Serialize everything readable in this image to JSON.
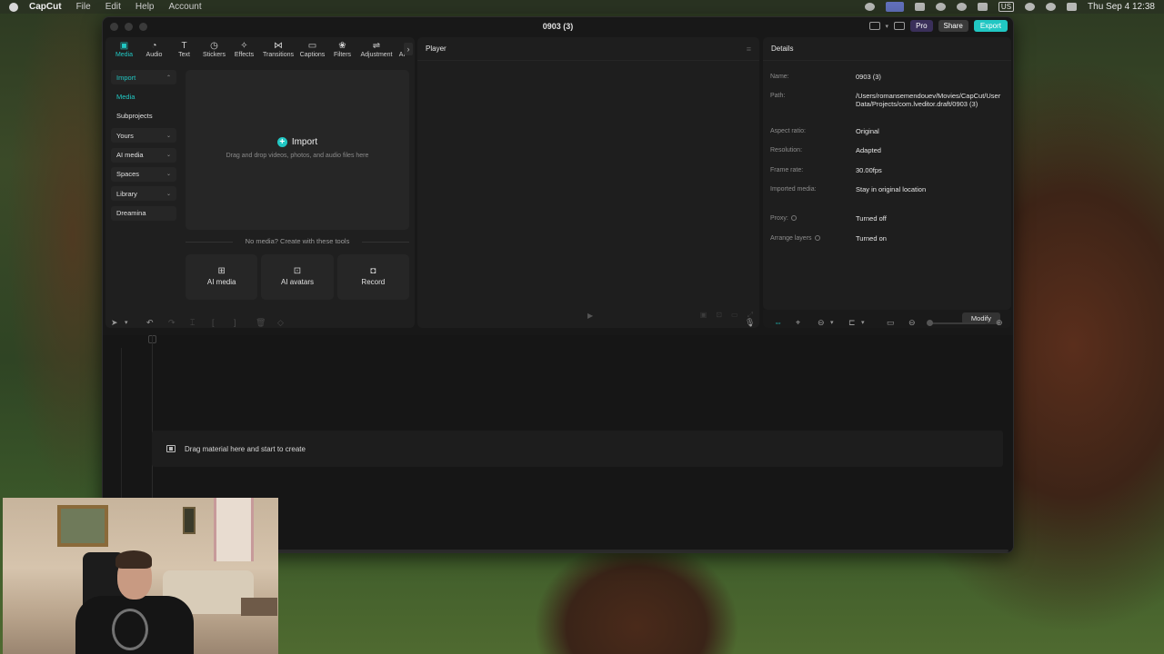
{
  "menubar": {
    "app": "CapCut",
    "menus": [
      "File",
      "Edit",
      "Help",
      "Account"
    ],
    "input_source": "US",
    "clock": "Thu Sep 4  12:38"
  },
  "window": {
    "title": "0903 (3)",
    "pro_label": "Pro",
    "share_label": "Share",
    "export_label": "Export"
  },
  "tools": [
    {
      "label": "Media",
      "icon": "media-icon",
      "glyph": "▣"
    },
    {
      "label": "Audio",
      "icon": "audio-icon",
      "glyph": "◔"
    },
    {
      "label": "Text",
      "icon": "text-icon",
      "glyph": "T"
    },
    {
      "label": "Stickers",
      "icon": "stickers-icon",
      "glyph": "◷"
    },
    {
      "label": "Effects",
      "icon": "effects-icon",
      "glyph": "✧"
    },
    {
      "label": "Transitions",
      "icon": "transitions-icon",
      "glyph": "⋈"
    },
    {
      "label": "Captions",
      "icon": "captions-icon",
      "glyph": "▭"
    },
    {
      "label": "Filters",
      "icon": "filters-icon",
      "glyph": "❀"
    },
    {
      "label": "Adjustment",
      "icon": "adjustment-icon",
      "glyph": "⇌"
    },
    {
      "label": "AI",
      "icon": "ai-icon",
      "glyph": ""
    }
  ],
  "subnav": [
    {
      "label": "Import",
      "expanded": true
    },
    {
      "label": "Media"
    },
    {
      "label": "Subprojects"
    },
    {
      "label": "Yours"
    },
    {
      "label": "AI media"
    },
    {
      "label": "Spaces"
    },
    {
      "label": "Library"
    },
    {
      "label": "Dreamina"
    }
  ],
  "dropzone": {
    "import_label": "Import",
    "hint": "Drag and drop videos, photos, and audio files here"
  },
  "no_media_text": "No media? Create with these tools",
  "create_tools": [
    {
      "label": "AI media",
      "icon": "ai-media-icon"
    },
    {
      "label": "AI avatars",
      "icon": "ai-avatars-icon"
    },
    {
      "label": "Record",
      "icon": "record-icon"
    }
  ],
  "player": {
    "title": "Player"
  },
  "details": {
    "title": "Details",
    "rows": [
      {
        "label": "Name:",
        "value": "0903 (3)"
      },
      {
        "label": "Path:",
        "value": "/Users/romansemendouev/Movies/CapCut/User Data/Projects/com.lveditor.draft/0903 (3)"
      },
      {
        "label": "Aspect ratio:",
        "value": "Original"
      },
      {
        "label": "Resolution:",
        "value": "Adapted"
      },
      {
        "label": "Frame rate:",
        "value": "30.00fps"
      },
      {
        "label": "Imported media:",
        "value": "Stay in original location"
      },
      {
        "label": "Proxy:",
        "value": "Turned off"
      },
      {
        "label": "Arrange layers",
        "value": "Turned on"
      }
    ],
    "modify_label": "Modify"
  },
  "timeline": {
    "drop_text": "Drag material here and start to create"
  },
  "colors": {
    "accent": "#21c7c3",
    "window_bg": "#181818",
    "panel_bg": "#1e1e1e"
  }
}
